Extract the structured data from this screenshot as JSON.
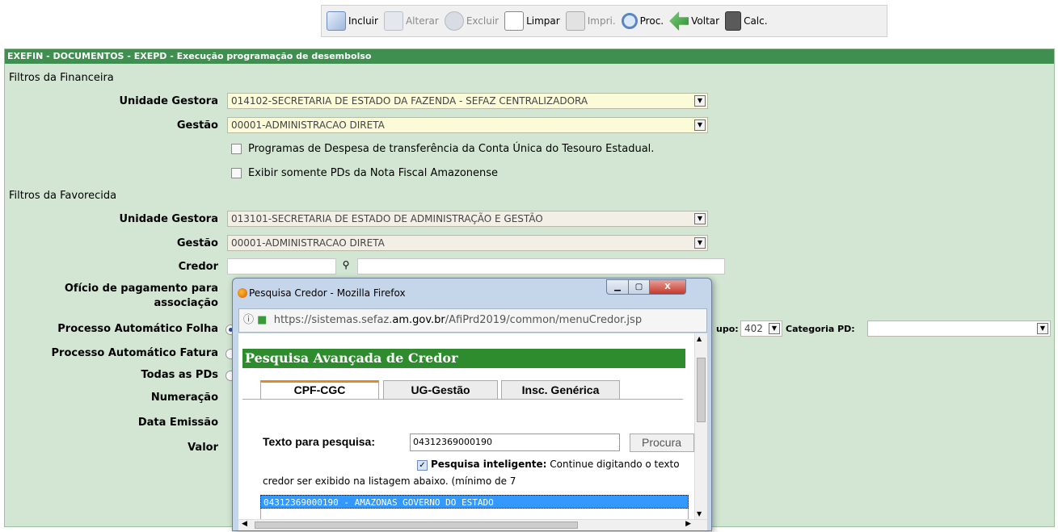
{
  "toolbar": {
    "buttons": [
      {
        "label": "Incluir",
        "icon": "add-doc-icon",
        "enabled": true
      },
      {
        "label": "Alterar",
        "icon": "edit-icon",
        "enabled": false
      },
      {
        "label": "Excluir",
        "icon": "delete-icon",
        "enabled": false
      },
      {
        "label": "Limpar",
        "icon": "clear-icon",
        "enabled": true
      },
      {
        "label": "Impri.",
        "icon": "print-icon",
        "enabled": false
      },
      {
        "label": "Proc.",
        "icon": "search-icon",
        "enabled": true
      },
      {
        "label": "Voltar",
        "icon": "back-arrow-icon",
        "enabled": true
      },
      {
        "label": "Calc.",
        "icon": "calculator-icon",
        "enabled": true
      }
    ]
  },
  "panel": {
    "title": "EXEFIN - DOCUMENTOS - EXEPD - Execução programação de desembolso",
    "financeira": {
      "section": "Filtros da Financeira",
      "ug_label": "Unidade Gestora",
      "ug_value": "014102-SECRETARIA DE ESTADO DA FAZENDA - SEFAZ CENTRALIZADORA",
      "gestao_label": "Gestão",
      "gestao_value": "00001-ADMINISTRACAO DIRETA",
      "check1": "Programas de Despesa de transferência da Conta Única do Tesouro Estadual.",
      "check2": "Exibir somente PDs da Nota Fiscal Amazonense"
    },
    "favorecida": {
      "section": "Filtros da Favorecida",
      "ug_label": "Unidade Gestora",
      "ug_value": "013101-SECRETARIA DE ESTADO DE ADMINISTRAÇÃO E GESTÃO",
      "gestao_label": "Gestão",
      "gestao_value": "00001-ADMINISTRACAO DIRETA",
      "credor_label": "Credor",
      "oficio_label_1": "Ofício de pagamento para",
      "oficio_label_2": "associação",
      "folha_label": "Processo Automático Folha",
      "fatura_label": "Processo Automático Fatura",
      "todas_label": "Todas as PDs",
      "numeracao_label": "Numeração",
      "emissao_label": "Data Emissão",
      "valor_label": "Valor",
      "grupo_suffix": "upo:",
      "grupo_value": "402",
      "categoria_label": "Categoria PD:",
      "categoria_value": ""
    }
  },
  "popup": {
    "title": "Pesquisa Credor - Mozilla Firefox",
    "url_prefix": "https://sistemas.sefaz.",
    "url_domain": "am.gov.br",
    "url_path": "/AfiPrd2019/common/menuCredor.jsp",
    "header": "Pesquisa Avançada de Credor",
    "tabs": [
      "CPF-CGC",
      "UG-Gestão",
      "Insc. Genérica"
    ],
    "search_label": "Texto para pesquisa:",
    "search_value": "04312369000190",
    "search_button": "Procura",
    "smart_label": "Pesquisa inteligente:",
    "smart_text_1": "Continue digitando o texto",
    "smart_text_2": "credor ser exibido na listagem abaixo. (mínimo de 7",
    "result": "04312369000190 - AMAZONAS GOVERNO DO ESTADO"
  }
}
